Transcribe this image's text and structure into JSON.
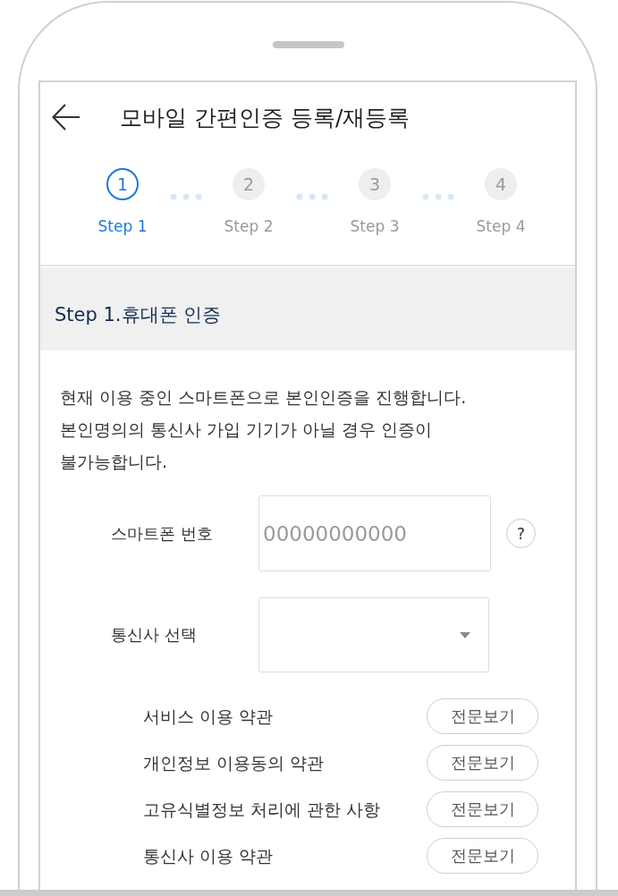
{
  "header": {
    "title": "모바일 간편인증 등록/재등록"
  },
  "steps": [
    {
      "number": "1",
      "label": "Step 1",
      "selected": true
    },
    {
      "number": "2",
      "label": "Step 2",
      "selected": false
    },
    {
      "number": "3",
      "label": "Step 3",
      "selected": false
    },
    {
      "number": "4",
      "label": "Step 4",
      "selected": false
    }
  ],
  "section": {
    "title": "Step 1.휴대폰 인증",
    "description_lines": [
      "현재 이용 중인 스마트폰으로 본인인증을 진행합니다.",
      "본인명의의 통신사 가입 기기가 아닐 경우 인증이",
      "불가능합니다."
    ]
  },
  "form": [
    {
      "kind": "text",
      "label": "스마트폰 번호",
      "placeholder": "00000000000",
      "help": "?"
    },
    {
      "kind": "select",
      "label": "통신사 선택"
    }
  ],
  "terms": [
    {
      "label": "서비스 이용 약관",
      "button": "전문보기"
    },
    {
      "label": "개인정보 이용동의 약관",
      "button": "전문보기"
    },
    {
      "label": "고유식별정보 처리에 관한 사항",
      "button": "전문보기"
    },
    {
      "label": "통신사 이용 약관",
      "button": "전문보기"
    }
  ]
}
